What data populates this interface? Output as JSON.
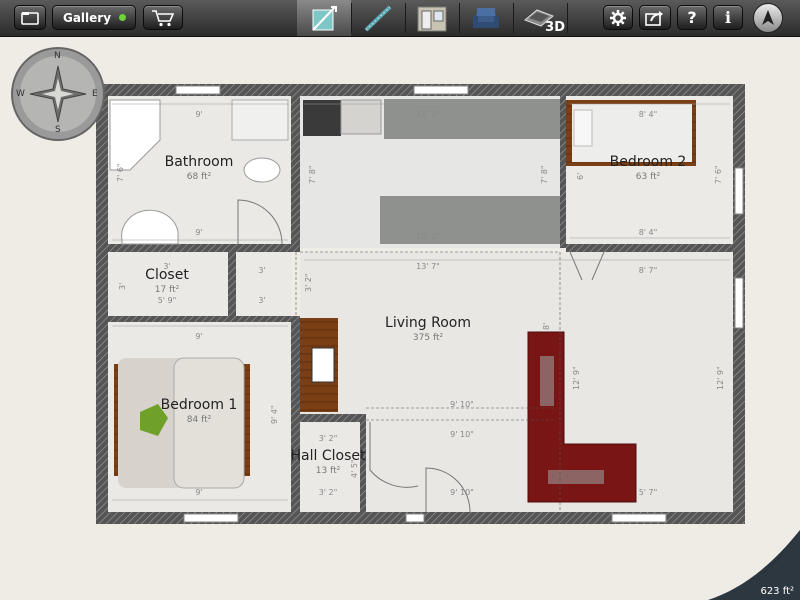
{
  "toolbar": {
    "gallery_label": "Gallery",
    "view_3d_label": "3D",
    "tools": [
      "wall-tool",
      "line-tool",
      "door-window-tool",
      "furniture-tool",
      "3d-view"
    ]
  },
  "compass": {
    "n": "N",
    "s": "S",
    "e": "E",
    "w": "W"
  },
  "rooms": {
    "bathroom": {
      "name": "Bathroom",
      "area": "68 ft²"
    },
    "bedroom2": {
      "name": "Bedroom 2",
      "area": "63 ft²"
    },
    "closet": {
      "name": "Closet",
      "area": "17 ft²"
    },
    "living": {
      "name": "Living Room",
      "area": "375 ft²"
    },
    "bedroom1": {
      "name": "Bedroom 1",
      "area": "84 ft²"
    },
    "hallcloset": {
      "name": "Hall Closet",
      "area": "13 ft²"
    }
  },
  "dims": {
    "bath_top": "9'",
    "bath_bot": "9'",
    "bath_side": "7' 6\"",
    "kitchen_top": "11' 2\"",
    "kitchen_bot": "10' 2\"",
    "kitchen_left": "7' 8\"",
    "kitchen_right": "7' 8\"",
    "bed2_top": "8' 4\"",
    "bed2_bot": "8' 4\"",
    "bed2_left": "6'",
    "bed2_right": "7' 6\"",
    "living_top": "13' 7\"",
    "living_mid": "8' 7\"",
    "living_left": "3' 2\"",
    "closet_a": "3'",
    "closet_b": "5' 9\"",
    "closet_side": "3'",
    "small_a": "3'",
    "small_b": "3'",
    "bed1_top": "9'",
    "bed1_bot": "9'",
    "bed1_side": "9' 4\"",
    "hall_top": "3' 2\"",
    "hall_bot": "3' 2\"",
    "hall_side": "4' 5\"",
    "living_9a": "9' 10\"",
    "living_9b": "9' 10\"",
    "living_9c": "9' 10\"",
    "living_r1": "12' 9\"",
    "living_r2": "12' 9\"",
    "living_br": "5' 7\"",
    "living_8": "8'"
  },
  "total_area": "623 ft²",
  "colors": {
    "wall": "#4a4a4a",
    "floor": "#e9e8e4",
    "sofa": "#7a1515",
    "rug": "#8e918d"
  }
}
